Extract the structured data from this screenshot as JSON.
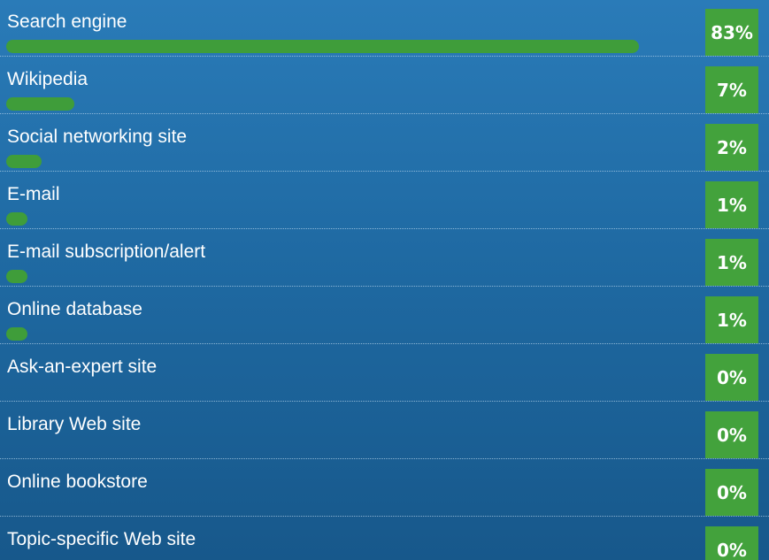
{
  "chart_data": {
    "type": "bar",
    "orientation": "horizontal",
    "categories": [
      "Search engine",
      "Wikipedia",
      "Social networking site",
      "E-mail",
      "E-mail subscription/alert",
      "Online database",
      "Ask-an-expert site",
      "Library Web site",
      "Online bookstore",
      "Topic-specific Web site"
    ],
    "values": [
      83,
      7,
      2,
      1,
      1,
      1,
      0,
      0,
      0,
      0
    ],
    "value_labels": [
      "83%",
      "7%",
      "2%",
      "1%",
      "1%",
      "1%",
      "0%",
      "0%",
      "0%",
      "0%"
    ],
    "xlim": [
      0,
      100
    ],
    "grid": false,
    "colors": {
      "bar": "#3f9d3a",
      "badge": "#43a23c",
      "background_top": "#2a7bb8",
      "background_bottom": "#17588b",
      "text": "#ffffff"
    }
  }
}
